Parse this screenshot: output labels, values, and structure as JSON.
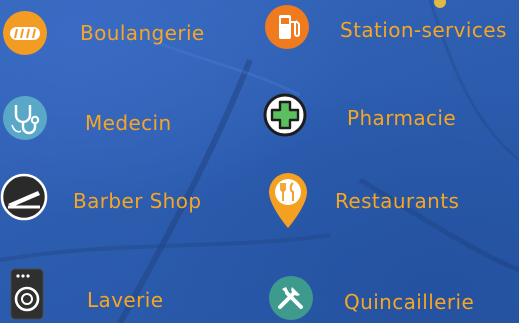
{
  "categories": [
    {
      "label": "Boulangerie",
      "icon": "bread-icon",
      "color": "#f39c24"
    },
    {
      "label": "Station-services",
      "icon": "fuel-pump-icon",
      "color": "#f07a1e"
    },
    {
      "label": "Medecin",
      "icon": "stethoscope-icon",
      "color": "#5aa8c8"
    },
    {
      "label": "Pharmacie",
      "icon": "pharmacy-cross-icon",
      "color": "#5bbf5f"
    },
    {
      "label": "Barber Shop",
      "icon": "razor-icon",
      "color": "#2a2a2a"
    },
    {
      "label": "Restaurants",
      "icon": "restaurant-pin-icon",
      "color": "#f4a020"
    },
    {
      "label": "Laverie",
      "icon": "washing-machine-icon",
      "color": "#2f2f2f"
    },
    {
      "label": "Quincaillerie",
      "icon": "tools-icon",
      "color": "#3e9a8c"
    }
  ]
}
